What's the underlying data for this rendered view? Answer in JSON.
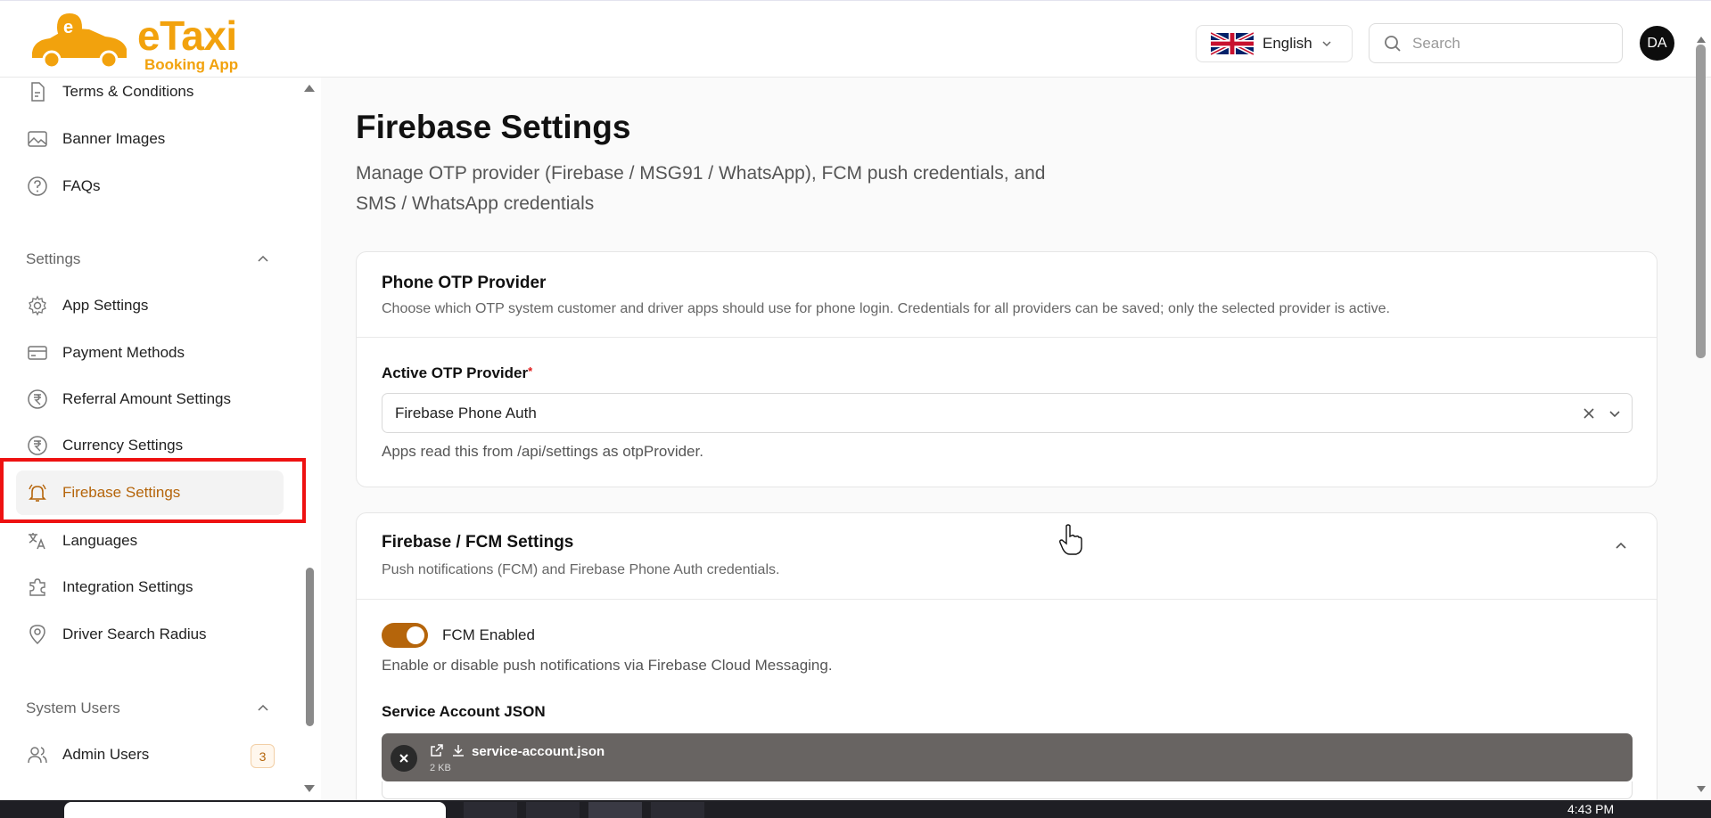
{
  "brand": {
    "name": "eTaxi",
    "tagline": "Booking App",
    "color": "#f2a20d"
  },
  "header": {
    "language": "English",
    "search_placeholder": "Search",
    "avatar_initials": "DA"
  },
  "sidebar": {
    "items_top": [
      {
        "label": "Terms & Conditions",
        "icon": "document-icon"
      },
      {
        "label": "Banner Images",
        "icon": "image-icon"
      },
      {
        "label": "FAQs",
        "icon": "question-icon"
      }
    ],
    "settings_section": "Settings",
    "settings_items": [
      {
        "label": "App Settings",
        "icon": "gear-icon"
      },
      {
        "label": "Payment Methods",
        "icon": "card-icon"
      },
      {
        "label": "Referral Amount Settings",
        "icon": "rupee-icon"
      },
      {
        "label": "Currency Settings",
        "icon": "rupee-icon"
      },
      {
        "label": "Firebase Settings",
        "icon": "bell-icon",
        "active": true
      },
      {
        "label": "Languages",
        "icon": "translate-icon"
      },
      {
        "label": "Integration Settings",
        "icon": "puzzle-icon"
      },
      {
        "label": "Driver Search Radius",
        "icon": "location-icon"
      }
    ],
    "system_users_section": "System Users",
    "system_users_items": [
      {
        "label": "Admin Users",
        "icon": "users-icon",
        "badge": "3"
      }
    ]
  },
  "main": {
    "title": "Firebase Settings",
    "subtitle": "Manage OTP provider (Firebase / MSG91 / WhatsApp), FCM push credentials, and SMS / WhatsApp credentials",
    "otp_card": {
      "title": "Phone OTP Provider",
      "description": "Choose which OTP system customer and driver apps should use for phone login. Credentials for all providers can be saved; only the selected provider is active.",
      "field_label": "Active OTP Provider",
      "required_mark": "*",
      "selected_value": "Firebase Phone Auth",
      "hint": "Apps read this from /api/settings as otpProvider."
    },
    "fcm_card": {
      "title": "Firebase / FCM Settings",
      "description": "Push notifications (FCM) and Firebase Phone Auth credentials.",
      "toggle_label": "FCM Enabled",
      "toggle_on": true,
      "toggle_hint": "Enable or disable push notifications via Firebase Cloud Messaging.",
      "json_label": "Service Account JSON",
      "file_name": "service-account.json",
      "file_size": "2 KB"
    }
  },
  "taskbar": {
    "clock": "4:43 PM"
  },
  "colors": {
    "accent": "#b5650b",
    "highlight": "#ee1111"
  }
}
